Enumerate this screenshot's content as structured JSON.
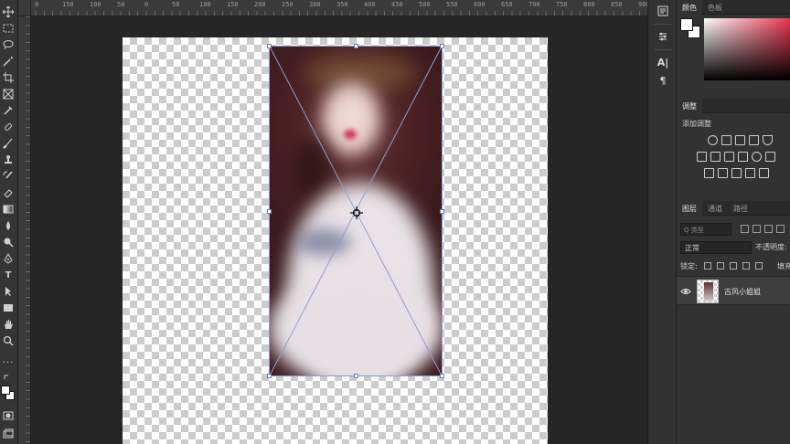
{
  "ruler": {
    "top_labels": [
      "0",
      "150",
      "100",
      "50",
      "0",
      "50",
      "100",
      "150",
      "200",
      "250",
      "300",
      "350",
      "400",
      "450",
      "500",
      "550",
      "600",
      "650",
      "700",
      "750",
      "800",
      "850",
      "900"
    ]
  },
  "panels": {
    "color_tabs": [
      "颜色",
      "色板"
    ],
    "adjustments_tab": "调整",
    "adjustments_title": "添加调整",
    "layers_tabs": [
      "图层",
      "通道",
      "路径"
    ],
    "layers_search_placeholder": "Q 类型",
    "blend_mode": "正常",
    "opacity_label": "不透明度:",
    "lock_label": "锁定:",
    "fill_label": "填充:",
    "layer_name": "古风小姐姐"
  },
  "colors": {
    "foreground": "#ffffff",
    "background": "#ffffff",
    "accent_hue": "#e8374f",
    "transform_box": "#8c9ecf"
  },
  "icons": {
    "tools": [
      "move-icon",
      "marquee-icon",
      "lasso-icon",
      "magic-wand-icon",
      "crop-icon",
      "frame-icon",
      "eyedropper-icon",
      "healing-brush-icon",
      "brush-icon",
      "clone-stamp-icon",
      "history-brush-icon",
      "eraser-icon",
      "gradient-icon",
      "blur-icon",
      "dodge-icon",
      "pen-icon",
      "type-icon",
      "path-select-icon",
      "rectangle-icon",
      "hand-icon",
      "zoom-icon",
      "more-tools-icon",
      "swap-colors-icon",
      "quick-mask-icon",
      "screen-mode-icon"
    ],
    "strip": [
      "history-icon",
      "properties-icon",
      "libraries-icon",
      "character-icon",
      "paragraph-icon"
    ]
  }
}
